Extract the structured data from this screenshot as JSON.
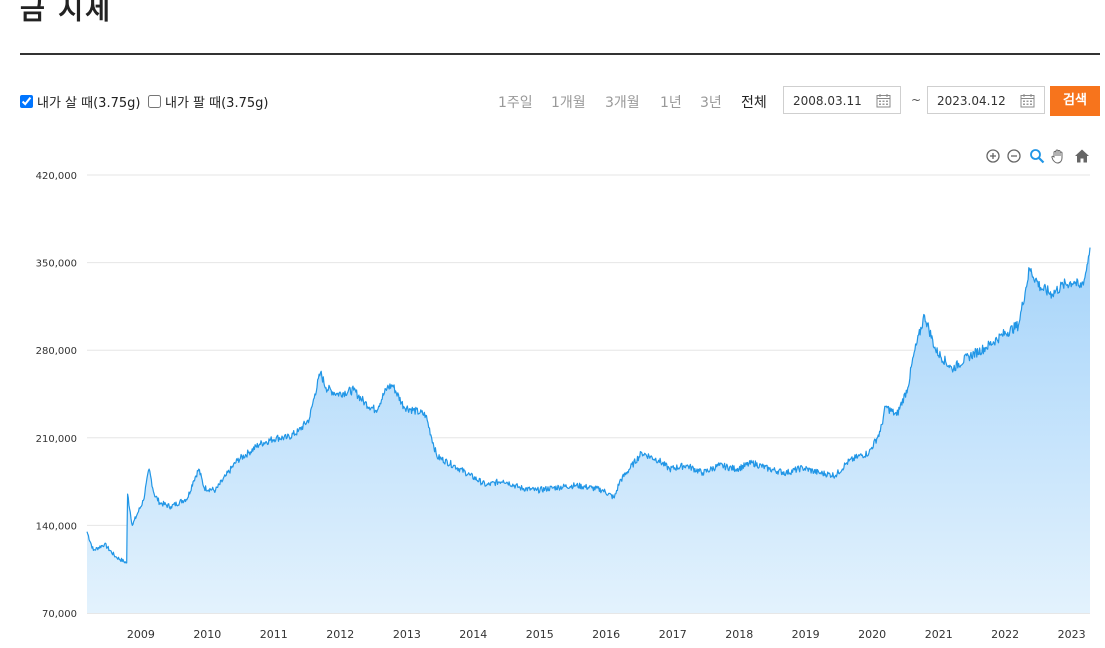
{
  "page": {
    "title": "금 시세"
  },
  "controls": {
    "buy_label": "내가 살 때(3.75g)",
    "buy_checked": true,
    "sell_label": "내가 팔 때(3.75g)",
    "sell_checked": false,
    "periods": [
      "1주일",
      "1개월",
      "3개월",
      "1년",
      "3년",
      "전체"
    ],
    "active_period": "전체",
    "start_date": "2008.03.11",
    "end_date": "2023.04.12",
    "range_separator": "~",
    "search_label": "검색",
    "accent_color": "#f7741c"
  },
  "toolbar": {
    "icons": [
      "zoom-in-icon",
      "zoom-out-icon",
      "zoom-selection-icon",
      "pan-hand-icon",
      "home-reset-icon"
    ]
  },
  "chart_data": {
    "type": "area",
    "title": "",
    "xlabel": "",
    "ylabel": "",
    "ylim": [
      70000,
      420000
    ],
    "yticks": [
      "420,000",
      "350,000",
      "280,000",
      "210,000",
      "140,000",
      "70,000"
    ],
    "ytick_values": [
      420000,
      350000,
      280000,
      210000,
      140000,
      70000
    ],
    "xticks": [
      "2009",
      "2010",
      "2011",
      "2012",
      "2013",
      "2014",
      "2015",
      "2016",
      "2017",
      "2018",
      "2019",
      "2020",
      "2021",
      "2022",
      "2023"
    ],
    "xlim": [
      "2008-03-11",
      "2023-04-12"
    ],
    "grid": true,
    "line_color": "#2196e6",
    "fill_color": "#a6d4fa",
    "series": [
      {
        "x": [
          "2008-03-11",
          "2008-04",
          "2008-06",
          "2008-08",
          "2008-10",
          "2008-10-20",
          "2008-11",
          "2008-12",
          "2009-01",
          "2009-02",
          "2009-03",
          "2009-04",
          "2009-06",
          "2009-09",
          "2009-10",
          "2009-11",
          "2009-12",
          "2010-02",
          "2010-04",
          "2010-06",
          "2010-08",
          "2010-10",
          "2011-01",
          "2011-03",
          "2011-05",
          "2011-07",
          "2011-08",
          "2011-09",
          "2011-10",
          "2011-12",
          "2012-03",
          "2012-05",
          "2012-07",
          "2012-09",
          "2012-10",
          "2012-12",
          "2013-03",
          "2013-04",
          "2013-06",
          "2013-09",
          "2013-12",
          "2014-03",
          "2014-06",
          "2014-09",
          "2014-12",
          "2015-03",
          "2015-07",
          "2015-10",
          "2015-12",
          "2016-02",
          "2016-03",
          "2016-07",
          "2016-10",
          "2016-12",
          "2017-03",
          "2017-06",
          "2017-09",
          "2017-12",
          "2018-03",
          "2018-06",
          "2018-09",
          "2018-12",
          "2019-03",
          "2019-06",
          "2019-08",
          "2019-10",
          "2019-12",
          "2020-02",
          "2020-03",
          "2020-05",
          "2020-07",
          "2020-08",
          "2020-10",
          "2020-12",
          "2021-03",
          "2021-06",
          "2021-09",
          "2021-12",
          "2022-03",
          "2022-05",
          "2022-07",
          "2022-09",
          "2022-11",
          "2023-01",
          "2023-02",
          "2023-03",
          "2023-04-12"
        ],
        "values": [
          135000,
          120000,
          125000,
          115000,
          110000,
          165000,
          140000,
          150000,
          160000,
          185000,
          165000,
          158000,
          155000,
          162000,
          175000,
          185000,
          170000,
          168000,
          180000,
          192000,
          198000,
          205000,
          210000,
          210000,
          215000,
          225000,
          245000,
          262000,
          250000,
          245000,
          248000,
          238000,
          232000,
          250000,
          252000,
          235000,
          230000,
          228000,
          195000,
          188000,
          180000,
          172000,
          176000,
          170000,
          168000,
          170000,
          172000,
          170000,
          168000,
          162000,
          175000,
          198000,
          192000,
          185000,
          188000,
          182000,
          188000,
          185000,
          190000,
          185000,
          182000,
          186000,
          182000,
          180000,
          190000,
          195000,
          198000,
          215000,
          235000,
          228000,
          250000,
          275000,
          308000,
          280000,
          265000,
          275000,
          282000,
          292000,
          300000,
          345000,
          330000,
          325000,
          332000,
          335000,
          330000,
          338000,
          362000
        ]
      }
    ]
  }
}
